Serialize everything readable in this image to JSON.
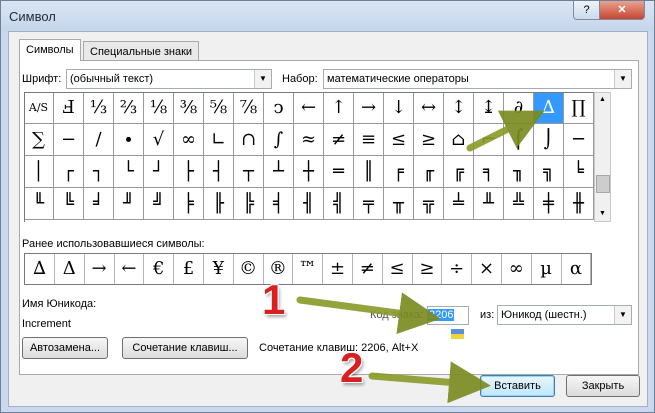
{
  "window": {
    "title": "Символ",
    "help_label": "?",
    "close_label": "✕"
  },
  "tabs": [
    {
      "label": "Символы"
    },
    {
      "label": "Специальные знаки"
    }
  ],
  "font": {
    "label": "Шрифт:",
    "value": "(обычный текст)"
  },
  "subset": {
    "label": "Набор:",
    "value": "математические операторы"
  },
  "grid": {
    "rows": [
      [
        "A/S",
        "Ⅎ",
        "⅓",
        "⅔",
        "⅛",
        "⅜",
        "⅝",
        "⅞",
        "ↄ",
        "←",
        "↑",
        "→",
        "↓",
        "↔",
        "↕",
        "↨",
        "∂",
        "∆",
        "∏"
      ],
      [
        "∑",
        "−",
        "∕",
        "∙",
        "√",
        "∞",
        "∟",
        "∩",
        "∫",
        "≈",
        "≠",
        "≡",
        "≤",
        "≥",
        "⌂",
        "⌐",
        "⌠",
        "⌡",
        "─"
      ],
      [
        "│",
        "┌",
        "┐",
        "└",
        "┘",
        "├",
        "┤",
        "┬",
        "┴",
        "┼",
        "═",
        "║",
        "╒",
        "╓",
        "╔",
        "╕",
        "╖",
        "╗",
        "╘"
      ],
      [
        "╙",
        "╚",
        "╛",
        "╜",
        "╝",
        "╞",
        "╟",
        "╠",
        "╡",
        "╢",
        "╣",
        "╤",
        "╥",
        "╦",
        "╧",
        "╨",
        "╩",
        "╪",
        "╫"
      ]
    ],
    "selected_symbol": "∆"
  },
  "recent": {
    "label": "Ранее использовавшиеся символы:",
    "symbols": [
      "∆",
      "Δ",
      "→",
      "←",
      "€",
      "£",
      "¥",
      "©",
      "®",
      "™",
      "±",
      "≠",
      "≤",
      "≥",
      "÷",
      "×",
      "∞",
      "µ",
      "α"
    ]
  },
  "unicode_name": {
    "label": "Имя Юникода:",
    "value": "Increment"
  },
  "code": {
    "label": "Код знака:",
    "value": "2206"
  },
  "from": {
    "label": "из:",
    "value": "Юникод (шестн.)"
  },
  "buttons": {
    "autocorrect": "Автозамена...",
    "shortcut_key": "Сочетание клавиш...",
    "insert": "Вставить",
    "close": "Закрыть"
  },
  "shortcut_text": "Сочетание клавиш: 2206, Alt+X",
  "annotations": {
    "badge1": "1",
    "badge2": "2",
    "arrow_color": "#8a9a28",
    "badge_color": "#d91f1f"
  }
}
